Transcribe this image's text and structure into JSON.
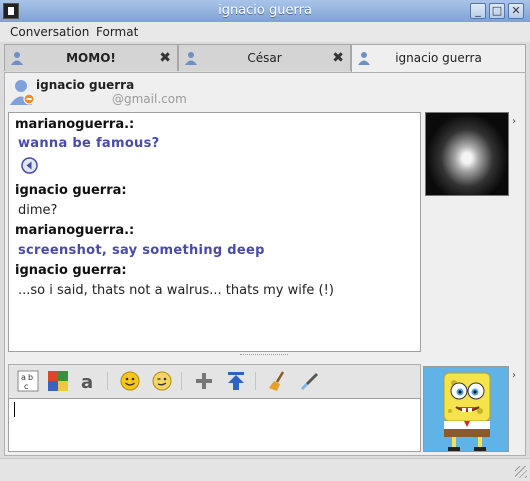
{
  "window": {
    "title": "ignacio guerra"
  },
  "menu": {
    "items": [
      "Conversation",
      "Format"
    ]
  },
  "tabs": [
    {
      "label": "MOMO!",
      "active": false,
      "bold": true
    },
    {
      "label": "César",
      "active": false,
      "bold": false
    },
    {
      "label": "ignacio guerra",
      "active": true,
      "bold": false
    }
  ],
  "contact": {
    "name": "ignacio guerra",
    "email": "@gmail.com"
  },
  "messages": [
    {
      "nick": "marianoguerra.:",
      "text": "wanna be famous?",
      "kind": "remote",
      "nudge": true
    },
    {
      "nick": "ignacio guerra:",
      "text": "dime?",
      "kind": "local"
    },
    {
      "nick": "marianoguerra.:",
      "text": "screenshot, say something deep",
      "kind": "remote"
    },
    {
      "nick": "ignacio guerra:",
      "text": "...so i said, thats not a walrus... thats my wife (!)",
      "kind": "local"
    }
  ],
  "toolbar": {
    "icons": [
      "font-icon",
      "color-icon",
      "text-style-icon",
      "smiley-icon",
      "wink-icon",
      "add-icon",
      "send-file-icon",
      "clean-icon",
      "dropper-icon"
    ]
  },
  "colors": {
    "accent": "#7fa2d4",
    "remote_text": "#4a4aa8"
  }
}
